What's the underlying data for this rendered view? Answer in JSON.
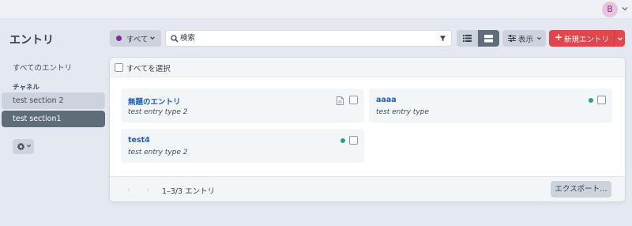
{
  "header": {
    "avatar_initial": "B"
  },
  "sidebar": {
    "title": "エントリ",
    "all_entries": "すべてのエントリ",
    "channel_heading": "チャネル",
    "sections": [
      {
        "label": "test section 2",
        "selected": false
      },
      {
        "label": "test section1",
        "selected": true
      }
    ]
  },
  "toolbar": {
    "status_filter_label": "すべて",
    "status_filter_color": "#7b2f8e",
    "search_placeholder": "検索",
    "display_label": "表示",
    "new_entry_label": "新規エントリ",
    "new_entry_plus": "+"
  },
  "main": {
    "select_all_label": "すべてを選択",
    "entries": [
      {
        "title": "無題のエントリ",
        "type": "test entry type 2",
        "status": "draft",
        "icon": "document-icon"
      },
      {
        "title": "aaaa",
        "type": "test entry type",
        "status": "live",
        "status_color": "#2e9d8c"
      },
      {
        "title": "test4",
        "type": "test entry type 2",
        "status": "live",
        "status_color": "#2e9d8c"
      }
    ],
    "pagination": {
      "prev": "‹",
      "next": "›",
      "info": "1–3/3 エントリ"
    },
    "export_label": "エクスポート…"
  },
  "colors": {
    "accent_red": "#e0464b",
    "link_blue": "#1f5fb5",
    "selected_nav": "#5f6d7a",
    "live_green": "#2e9d8c"
  }
}
